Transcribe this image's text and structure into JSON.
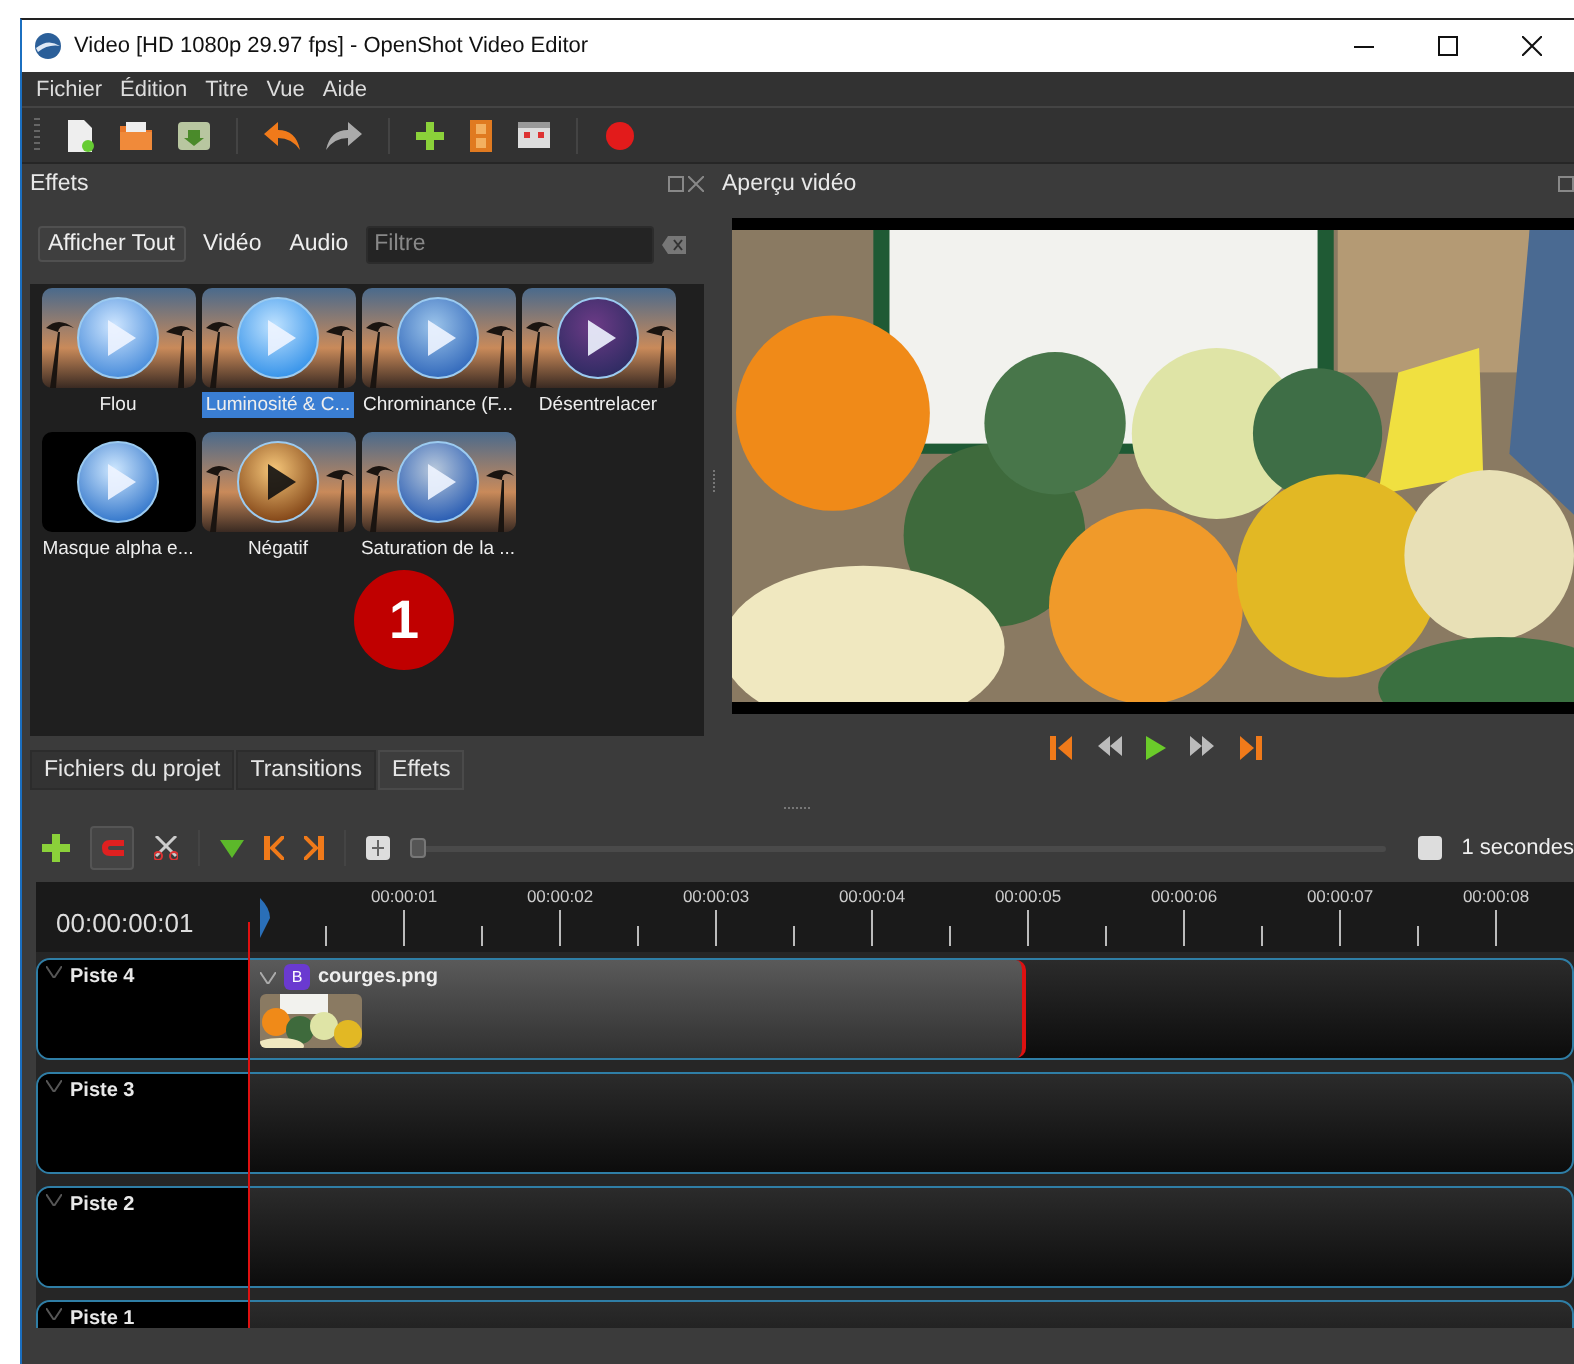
{
  "window": {
    "title": "Video [HD 1080p 29.97 fps] - OpenShot Video Editor"
  },
  "menu": [
    "Fichier",
    "Édition",
    "Titre",
    "Vue",
    "Aide"
  ],
  "effects_panel": {
    "title": "Effets",
    "filters": [
      {
        "label": "Afficher Tout",
        "selected": true
      },
      {
        "label": "Vidéo",
        "selected": false
      },
      {
        "label": "Audio",
        "selected": false
      }
    ],
    "search": {
      "placeholder": "Filtre"
    },
    "items": [
      {
        "label": "Flou",
        "selected": false
      },
      {
        "label": "Luminosité & C...",
        "selected": true
      },
      {
        "label": "Chrominance (F...",
        "selected": false
      },
      {
        "label": "Désentrelacer",
        "selected": false
      },
      {
        "label": "Masque alpha e...",
        "selected": false
      },
      {
        "label": "Négatif",
        "selected": false
      },
      {
        "label": "Saturation de la ...",
        "selected": false
      }
    ],
    "badge": "1"
  },
  "bottom_tabs": [
    {
      "label": "Fichiers du projet",
      "selected": false
    },
    {
      "label": "Transitions",
      "selected": false
    },
    {
      "label": "Effets",
      "selected": true
    }
  ],
  "preview": {
    "title": "Aperçu vidéo"
  },
  "timeline": {
    "zoom_slider": {
      "level": 0
    },
    "zoom_label": "1 secondes",
    "timecode": "00:00:00:01",
    "ticks": [
      "00:00:01",
      "00:00:02",
      "00:00:03",
      "00:00:04",
      "00:00:05",
      "00:00:06",
      "00:00:07",
      "00:00:08"
    ],
    "tracks": [
      {
        "name": "Piste 4",
        "clips": [
          {
            "name": "courges.png",
            "badge": "B"
          }
        ]
      },
      {
        "name": "Piste 3"
      },
      {
        "name": "Piste 2"
      },
      {
        "name": "Piste 1"
      }
    ]
  }
}
